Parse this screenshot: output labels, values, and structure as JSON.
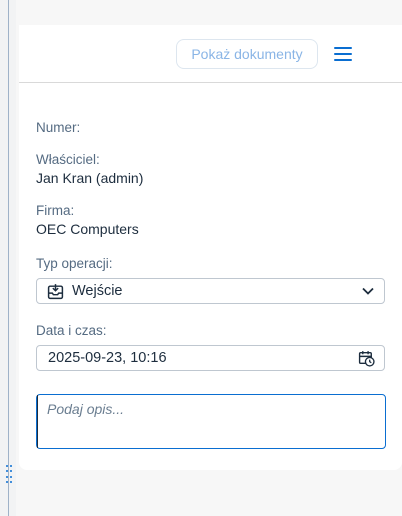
{
  "header": {
    "show_docs_label": "Pokaż dokumenty"
  },
  "fields": {
    "number": {
      "label": "Numer:"
    },
    "owner": {
      "label": "Właściciel:",
      "value": "Jan Kran (admin)"
    },
    "company": {
      "label": "Firma:",
      "value": "OEC Computers"
    },
    "operation_type": {
      "label": "Typ operacji:",
      "value": "Wejście"
    },
    "datetime": {
      "label": "Data i czas:",
      "value": "2025-09-23, 10:16"
    },
    "description": {
      "placeholder": "Podaj opis..."
    }
  },
  "icons": {
    "operation": "inbox-in-icon",
    "datetime": "calendar-clock-icon",
    "menu": "hamburger-menu-icon"
  },
  "colors": {
    "accent": "#0a6ed1",
    "label": "#556b82",
    "text": "#1d2d3e"
  }
}
